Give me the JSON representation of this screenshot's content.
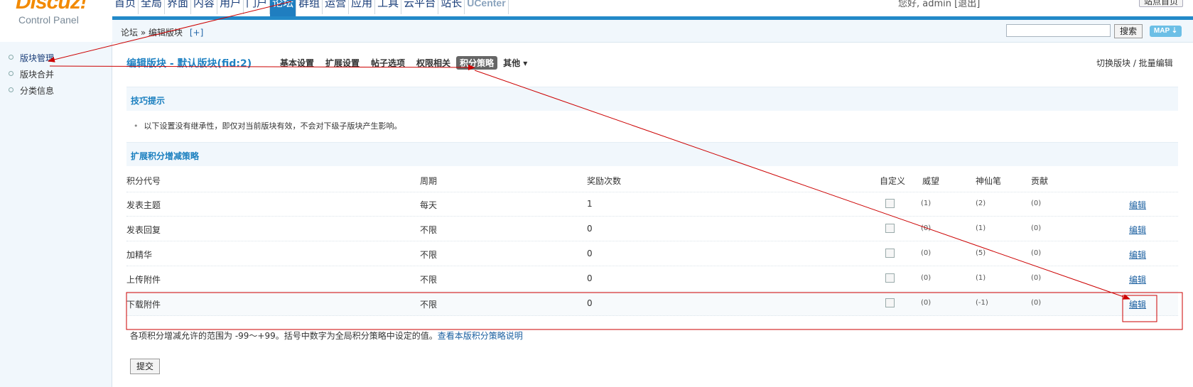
{
  "header": {
    "logo": "Discuz!",
    "subtitle": "Control Panel",
    "nav": [
      "首页",
      "全局",
      "界面",
      "内容",
      "用户",
      "门户",
      "论坛",
      "群组",
      "运营",
      "应用",
      "工具",
      "云平台",
      "站长",
      "UCenter"
    ],
    "active_nav": "论坛",
    "user_text": "您好, admin [退出]",
    "site_button": "站点首页"
  },
  "breadcrumb": {
    "root": "论坛",
    "sep": "»",
    "current": "编辑版块",
    "plus": "[+]"
  },
  "search": {
    "button": "搜索",
    "map": "MAP ⇣"
  },
  "sidebar": {
    "items": [
      "版块管理",
      "版块合并",
      "分类信息"
    ]
  },
  "main": {
    "title": "编辑版块 - 默认版块(fid:2)",
    "tabs": [
      "基本设置",
      "扩展设置",
      "帖子选项",
      "权限相关",
      "积分策略",
      "其他 ▾"
    ],
    "active_tab": "积分策略",
    "switch_links": "切换版块 / 批量编辑"
  },
  "tips": {
    "title": "技巧提示",
    "text": "以下设置没有继承性，即仅对当前版块有效，不会对下级子版块产生影响。"
  },
  "strategy": {
    "title": "扩展积分增减策略",
    "headers": [
      "积分代号",
      "周期",
      "奖励次数",
      "自定义",
      "威望",
      "神仙笔",
      "贡献"
    ],
    "rows": [
      {
        "name": "发表主题",
        "cycle": "每天",
        "times": "1",
        "v1": "(1)",
        "v2": "(2)",
        "v3": "(0)",
        "edit": "编辑"
      },
      {
        "name": "发表回复",
        "cycle": "不限",
        "times": "0",
        "v1": "(0)",
        "v2": "(1)",
        "v3": "(0)",
        "edit": "编辑"
      },
      {
        "name": "加精华",
        "cycle": "不限",
        "times": "0",
        "v1": "(0)",
        "v2": "(5)",
        "v3": "(0)",
        "edit": "编辑"
      },
      {
        "name": "上传附件",
        "cycle": "不限",
        "times": "0",
        "v1": "(0)",
        "v2": "(1)",
        "v3": "(0)",
        "edit": "编辑"
      },
      {
        "name": "下载附件",
        "cycle": "不限",
        "times": "0",
        "v1": "(0)",
        "v2": "(-1)",
        "v3": "(0)",
        "edit": "编辑"
      }
    ],
    "note": "各项积分增减允许的范围为 -99～+99。括号中数字为全局积分策略中设定的值。",
    "note_link": "查看本版积分策略说明"
  },
  "submit_label": "提交",
  "colors": {
    "accent": "#1f7ec0",
    "annotation": "#cc0000"
  }
}
